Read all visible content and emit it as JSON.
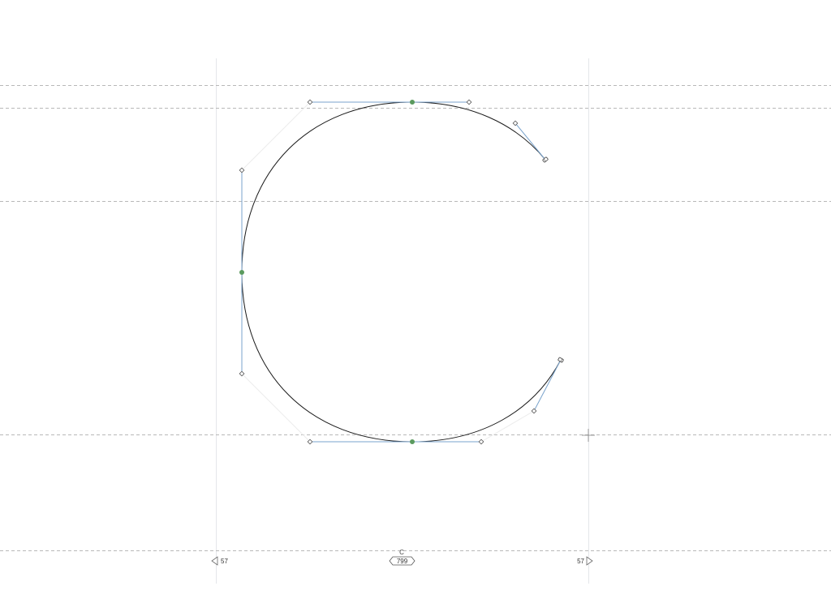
{
  "editor": {
    "glyph_name": "C",
    "advance_width": "799",
    "left_sidebearing": "57",
    "right_sidebearing": "57"
  },
  "colors": {
    "canvas_bg": "#ffffff",
    "metric_line": "#b8b8b8",
    "sidebearing_line": "#e6e6e8",
    "outline_stroke": "#1a1a1a",
    "handle_line": "#7aa3cc",
    "on_curve_smooth": "#5a9a5e",
    "off_curve_fill": "#ffffff",
    "off_curve_stroke": "#555555",
    "label_text": "#333333"
  },
  "icons": {
    "left_sidebearing_arrow": "left-triangle-icon",
    "right_sidebearing_arrow": "right-triangle-icon",
    "advance_width_badge": "hexagon-badge-icon",
    "cursor": "crosshair-icon",
    "open_endpoint": "endpoint-marker-icon"
  }
}
